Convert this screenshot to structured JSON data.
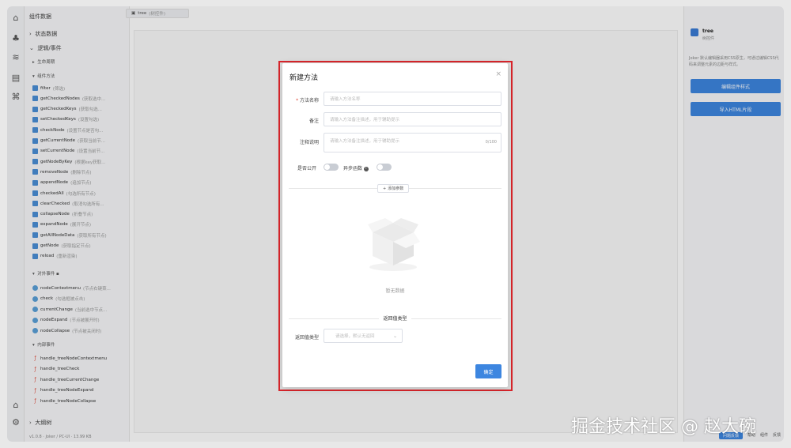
{
  "tree": {
    "title": "组件数据",
    "state_section": "状态数据",
    "logic_section": "逻辑/事件",
    "lifecycle": "生命周期",
    "methods_group": "组件方法",
    "methods": [
      {
        "name": "filter",
        "note": "(筛选)"
      },
      {
        "name": "getCheckedNodes",
        "note": "(获取选中..."
      },
      {
        "name": "getCheckedKeys",
        "note": "(获取勾选..."
      },
      {
        "name": "setCheckedKeys",
        "note": "(设置勾选)"
      },
      {
        "name": "checkNode",
        "note": "(设置节点是否勾..."
      },
      {
        "name": "getCurrentNode",
        "note": "(获取当前节..."
      },
      {
        "name": "setCurrentNode",
        "note": "(设置当前节..."
      },
      {
        "name": "getNodeByKey",
        "note": "(根据key获取..."
      },
      {
        "name": "removeNode",
        "note": "(删除节点)"
      },
      {
        "name": "appendNode",
        "note": "(追加节点)"
      },
      {
        "name": "checkedAll",
        "note": "(勾选所有节点)"
      },
      {
        "name": "clearChecked",
        "note": "(取消勾选所有..."
      },
      {
        "name": "collapseNode",
        "note": "(折叠节点)"
      },
      {
        "name": "expandNode",
        "note": "(展开节点)"
      },
      {
        "name": "getAllNodeData",
        "note": "(获取所有节点)"
      },
      {
        "name": "getNode",
        "note": "(获取指定节点)"
      },
      {
        "name": "reload",
        "note": "(重新渲染)"
      }
    ],
    "external_events": "对外事件",
    "events": [
      {
        "name": "nodeContextmenu",
        "note": "(节点右键菜..."
      },
      {
        "name": "check",
        "note": "(勾选框被点击)"
      },
      {
        "name": "currentChange",
        "note": "(当前选中节点..."
      },
      {
        "name": "nodeExpand",
        "note": "(节点被展开时)"
      },
      {
        "name": "nodeCollapse",
        "note": "(节点被关闭时)"
      }
    ],
    "internal_events": "内部事件",
    "handlers": [
      "handle_treeNodeContextmenu",
      "handle_treeCheck",
      "handle_treeCurrentChange",
      "handle_treeNodeExpand",
      "handle_treeNodeCollapse"
    ],
    "outline": "大纲树",
    "footer": "v1.0.8 · Joker / PC-UI · 13.99 KB"
  },
  "canvas": {
    "tab_label": "tree",
    "tab_note": "(树控件)"
  },
  "right_panel": {
    "name": "tree",
    "subtitle": "树控件",
    "note": "Joker 默认编辑器采用CSS原生，可通过编辑CSS代码来调整元素的边距与样式。",
    "btn_style": "编辑组件样式",
    "btn_html": "导入HTML片段",
    "bottom_pill": "问题反馈",
    "bottom_items": [
      "帮助",
      "组件",
      "反馈"
    ]
  },
  "dialog": {
    "title": "新建方法",
    "close": "×",
    "method_name_label": "方法名称",
    "method_name_placeholder": "请输入方法名称",
    "remark_label": "备注",
    "remark_placeholder": "请输入方法备注描述，用于辅助提示",
    "comment_label": "注释说明",
    "comment_placeholder": "请输入方法备注描述，用于辅助提示",
    "comment_counter": "0/100",
    "public_label": "是否公开",
    "async_label": "异步函数",
    "add_param": "添加参数",
    "empty_text": "暂无数据",
    "return_section": "返回值类型",
    "return_label": "返回值类型",
    "return_placeholder": "请选择，默认无返回",
    "confirm": "确定"
  },
  "watermark": "掘金技术社区 @ 赵大碗"
}
